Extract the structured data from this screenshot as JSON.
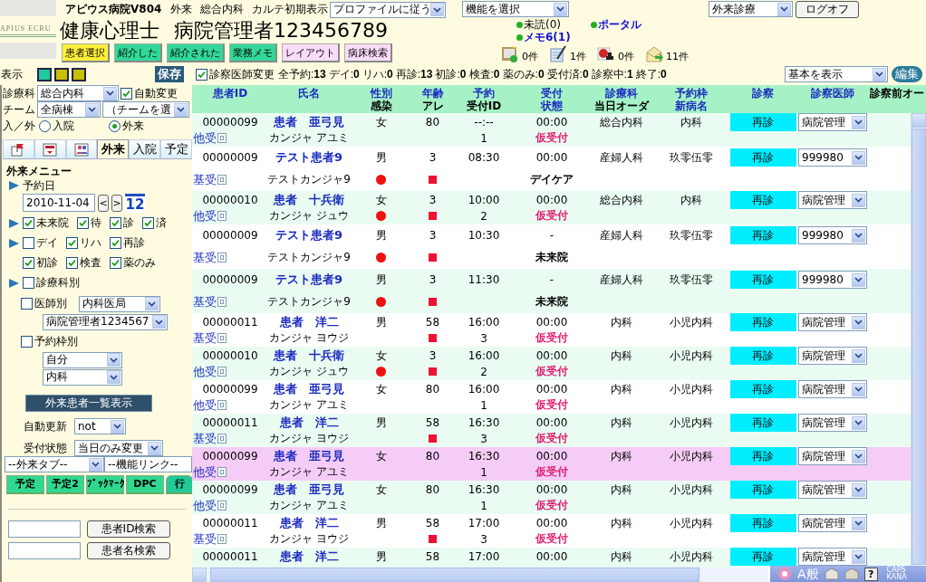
{
  "header": {
    "logo": "APIUS ECRU",
    "hospital": "アピウス病院V804",
    "mode": "外来",
    "department": "総合内科",
    "chart_label": "カルテ初期表示",
    "chart_select": "プロファイルに従う",
    "function_select": "機能を選択",
    "user_title": "健康心理士",
    "user_name": "病院管理者123456789",
    "nav_buttons": [
      {
        "label": "患者選択",
        "color": "#fff03a"
      },
      {
        "label": "紹介した",
        "color": "#33d898"
      },
      {
        "label": "紹介された",
        "color": "#33d898"
      },
      {
        "label": "業務メモ",
        "color": "#33d898"
      },
      {
        "label": "レイアウト",
        "color": "#f8dcf8"
      },
      {
        "label": "病床検索",
        "color": "#f8dcf8"
      }
    ],
    "notices": [
      {
        "label": "未読(0)",
        "kind": "plain"
      },
      {
        "label": "ポータル",
        "kind": "link"
      },
      {
        "label": "メモ6(1)",
        "kind": "link"
      }
    ],
    "counters": [
      {
        "kind": "board",
        "count": "0件"
      },
      {
        "kind": "notepad",
        "count": "1件"
      },
      {
        "kind": "stamp",
        "count": "0件"
      },
      {
        "kind": "envelope",
        "count": "11件"
      }
    ],
    "clinic_select": "外来診療",
    "logoff": "ログオフ"
  },
  "toolbar": {
    "display_label": "表示",
    "swatches": [
      {
        "color": "#22c8a0"
      },
      {
        "color": "#c8c000"
      },
      {
        "color": "#c8c000"
      }
    ],
    "save": "保存",
    "doctor_change": {
      "label": "診察医師変更",
      "checked": true
    },
    "stats": [
      "全予約:**13**",
      "デイ:**0**",
      "リハ:**0**",
      "再診:**13**",
      "初診:**0**",
      "検査:**0**",
      "薬のみ:**0**",
      "受付済:**0**",
      "診察中:**1**",
      "終了:**0**"
    ],
    "view_select": "基本を表示",
    "edit": "編集"
  },
  "sidebar": {
    "dept": {
      "label": "診療科",
      "value": "総合内科"
    },
    "auto_change": {
      "label": "自動変更",
      "checked": true
    },
    "team": {
      "label": "チーム",
      "ward": "全病棟",
      "team": "（チームを選"
    },
    "inout": {
      "label": "入／外",
      "options": [
        {
          "label": "入院",
          "selected": false
        },
        {
          "label": "外来",
          "selected": true
        }
      ]
    },
    "tabs": [
      {
        "kind": "flag",
        "selected": false
      },
      {
        "kind": "form",
        "selected": false
      },
      {
        "kind": "people",
        "selected": false
      },
      {
        "label": "外来",
        "selected": true
      },
      {
        "label": "入院",
        "selected": false
      },
      {
        "label": "予定",
        "selected": false
      }
    ],
    "menu_title": "外来メニュー",
    "date_label": "予約日",
    "date": "2010-11-04",
    "prev": "<",
    "next": ">",
    "calendar": "12",
    "filters": [
      {
        "arrow": true,
        "items": [
          {
            "label": "未来院",
            "checked": true
          },
          {
            "label": "待",
            "checked": true
          },
          {
            "label": "診",
            "checked": true
          },
          {
            "label": "済",
            "checked": true
          }
        ]
      },
      {
        "arrow": true,
        "items": [
          {
            "label": "デイ",
            "checked": false
          },
          {
            "label": "リハ",
            "checked": true
          },
          {
            "label": "再診",
            "checked": true
          }
        ]
      },
      {
        "items": [
          {
            "label": "初診",
            "checked": true
          },
          {
            "label": "検査",
            "checked": true
          },
          {
            "label": "薬のみ",
            "checked": true
          }
        ]
      },
      {
        "arrow": true,
        "items": [
          {
            "label": "診療科別",
            "checked": false
          }
        ]
      }
    ],
    "doctor": {
      "label": "医師別",
      "checked": false,
      "group": "内科医局",
      "doctor": "病院管理者1234567"
    },
    "frame": {
      "label": "予約枠別",
      "checked": false,
      "owner": "自分",
      "dept": "内科"
    },
    "list_button": "外来患者一覧表示",
    "auto_refresh": {
      "label": "自動更新",
      "value": "not"
    },
    "reception": {
      "label": "受付状態",
      "value": "当日のみ変更"
    },
    "tab_select": "--外来タブ--",
    "link_select": "--機能リンク--",
    "quick_buttons": [
      {
        "label": "予定",
        "kind": "plain"
      },
      {
        "label": "予定2",
        "kind": "plain"
      },
      {
        "label": "ﾌﾞｯｸﾏｰｸ",
        "kind": "plain"
      },
      {
        "label": "DPC",
        "kind": "plain"
      },
      {
        "label": "行",
        "kind": "tab"
      }
    ],
    "id_search": "患者ID検索",
    "name_search": "患者名検索"
  },
  "table": {
    "columns": [
      {
        "labels": [
          {
            "text": "患者ID",
            "kind": "link"
          }
        ]
      },
      {
        "labels": [
          {
            "text": "氏名",
            "kind": "link"
          }
        ]
      },
      {
        "labels": [
          {
            "text": "性別",
            "kind": "link"
          },
          {
            "text": "感染",
            "kind": "plain"
          }
        ]
      },
      {
        "labels": [
          {
            "text": "年齢",
            "kind": "link"
          },
          {
            "text": "アレ",
            "kind": "plain"
          }
        ]
      },
      {
        "labels": [
          {
            "text": "予約",
            "kind": "link"
          },
          {
            "text": "受付ID",
            "kind": "plain"
          }
        ]
      },
      {
        "labels": [
          {
            "text": "受付",
            "kind": "link"
          },
          {
            "text": "状態",
            "kind": "link"
          }
        ]
      },
      {
        "labels": [
          {
            "text": "診療科",
            "kind": "link"
          },
          {
            "text": "当日オーダ",
            "kind": "plain"
          }
        ]
      },
      {
        "labels": [
          {
            "text": "予約枠",
            "kind": "link"
          },
          {
            "text": "新病名",
            "kind": "link"
          }
        ]
      },
      {
        "labels": [
          {
            "text": "診察",
            "kind": "link"
          }
        ]
      },
      {
        "labels": [
          {
            "text": "診察医師",
            "kind": "link"
          }
        ]
      },
      {
        "labels": [
          {
            "text": "診察前オー",
            "kind": "plain"
          }
        ]
      }
    ],
    "rows": [
      {
        "id": "00000099",
        "type": "他受",
        "name": "患者　亜弓見",
        "kana": "カンジャ アユミ",
        "sex": "女",
        "age": "80",
        "infection": false,
        "allergy": false,
        "time": "--:--",
        "rid": "1",
        "rtime": "00:00",
        "status": {
          "label": "仮受付",
          "color": "#e01e70"
        },
        "dept": "総合内科",
        "frame": "内科",
        "exam": "再診",
        "doctor": "病院管理",
        "selected": false
      },
      {
        "id": "00000009",
        "type": "基受",
        "name": "テスト患者9",
        "kana": "テストカンジャ9",
        "sex": "男",
        "age": "3",
        "infection": true,
        "allergy": true,
        "time": "08:30",
        "rtime": "00:00",
        "status": {
          "label": "デイケア",
          "color": "#000000"
        },
        "dept": "産婦人科",
        "frame": "玖零伍零",
        "exam": "再診",
        "doctor": "999980",
        "selected": false
      },
      {
        "id": "00000010",
        "type": "他受",
        "name": "患者　十兵衛",
        "kana": "カンジャ ジュウ",
        "sex": "女",
        "age": "3",
        "infection": true,
        "allergy": true,
        "time": "10:00",
        "rid": "2",
        "rtime": "00:00",
        "status": {
          "label": "仮受付",
          "color": "#e01e70"
        },
        "dept": "総合内科",
        "frame": "内科",
        "exam": "再診",
        "doctor": "病院管理",
        "selected": false
      },
      {
        "id": "00000009",
        "type": "基受",
        "name": "テスト患者9",
        "kana": "テストカンジャ9",
        "sex": "男",
        "age": "3",
        "infection": true,
        "allergy": true,
        "time": "10:30",
        "rtime": "-",
        "status": {
          "label": "未来院",
          "color": "#000000"
        },
        "dept": "産婦人科",
        "frame": "玖零伍零",
        "exam": "再診",
        "doctor": "999980",
        "selected": false
      },
      {
        "id": "00000009",
        "type": "基受",
        "name": "テスト患者9",
        "kana": "テストカンジャ9",
        "sex": "男",
        "age": "3",
        "infection": true,
        "allergy": true,
        "time": "11:30",
        "rtime": "-",
        "status": {
          "label": "未来院",
          "color": "#000000"
        },
        "dept": "産婦人科",
        "frame": "玖零伍零",
        "exam": "再診",
        "doctor": "999980",
        "selected": false
      },
      {
        "id": "00000011",
        "type": "基受",
        "name": "患者　洋二",
        "kana": "カンジャ ヨウジ",
        "sex": "男",
        "age": "58",
        "infection": false,
        "allergy": true,
        "time": "16:00",
        "rid": "3",
        "rtime": "00:00",
        "status": {
          "label": "仮受付",
          "color": "#e01e70"
        },
        "dept": "内科",
        "frame": "小児内科",
        "exam": "再診",
        "doctor": "病院管理",
        "selected": false
      },
      {
        "id": "00000010",
        "type": "他受",
        "name": "患者　十兵衛",
        "kana": "カンジャ ジュウ",
        "sex": "女",
        "age": "3",
        "infection": true,
        "allergy": true,
        "time": "16:00",
        "rid": "2",
        "rtime": "00:00",
        "status": {
          "label": "仮受付",
          "color": "#e01e70"
        },
        "dept": "内科",
        "frame": "小児内科",
        "exam": "再診",
        "doctor": "病院管理",
        "selected": false
      },
      {
        "id": "00000099",
        "type": "他受",
        "name": "患者　亜弓見",
        "kana": "カンジャ アユミ",
        "sex": "女",
        "age": "80",
        "infection": false,
        "allergy": false,
        "time": "16:00",
        "rid": "1",
        "rtime": "00:00",
        "status": {
          "label": "仮受付",
          "color": "#e01e70"
        },
        "dept": "内科",
        "frame": "小児内科",
        "exam": "再診",
        "doctor": "病院管理",
        "selected": false
      },
      {
        "id": "00000011",
        "type": "基受",
        "name": "患者　洋二",
        "kana": "カンジャ ヨウジ",
        "sex": "男",
        "age": "58",
        "infection": false,
        "allergy": true,
        "time": "16:30",
        "rid": "3",
        "rtime": "00:00",
        "status": {
          "label": "仮受付",
          "color": "#e01e70"
        },
        "dept": "内科",
        "frame": "小児内科",
        "exam": "再診",
        "doctor": "病院管理",
        "selected": false
      },
      {
        "id": "00000099",
        "type": "他受",
        "name": "患者　亜弓見",
        "kana": "カンジャ アユミ",
        "sex": "女",
        "age": "80",
        "infection": false,
        "allergy": false,
        "time": "16:30",
        "rid": "1",
        "rtime": "00:00",
        "status": {
          "label": "仮受付",
          "color": "#e01e70"
        },
        "dept": "内科",
        "frame": "小児内科",
        "exam": "再診",
        "doctor": "病院管理",
        "selected": true
      },
      {
        "id": "00000099",
        "type": "他受",
        "name": "患者　亜弓見",
        "kana": "カンジャ アユミ",
        "sex": "女",
        "age": "80",
        "infection": false,
        "allergy": false,
        "time": "16:30",
        "rid": "1",
        "rtime": "00:00",
        "status": {
          "label": "仮受付",
          "color": "#e01e70"
        },
        "dept": "内科",
        "frame": "小児内科",
        "exam": "再診",
        "doctor": "病院管理",
        "selected": false
      },
      {
        "id": "00000011",
        "type": "基受",
        "name": "患者　洋二",
        "kana": "カンジャ ヨウジ",
        "sex": "男",
        "age": "58",
        "infection": false,
        "allergy": true,
        "time": "17:00",
        "rid": "3",
        "rtime": "00:00",
        "status": {
          "label": "仮受付",
          "color": "#e01e70"
        },
        "dept": "内科",
        "frame": "小児内科",
        "exam": "再診",
        "doctor": "病院管理",
        "selected": false
      },
      {
        "id": "00000011",
        "name": "患者　洋二",
        "sex": "男",
        "age": "58",
        "time": "17:00",
        "rtime": "00:00",
        "dept": "内科",
        "frame": "小児内科",
        "exam": "再診",
        "doctor": "病院管理",
        "selected": false
      }
    ]
  },
  "ime_bar": {
    "mode": "A般",
    "help": "?",
    "caps": "CAPS",
    "kana": "KANA"
  }
}
